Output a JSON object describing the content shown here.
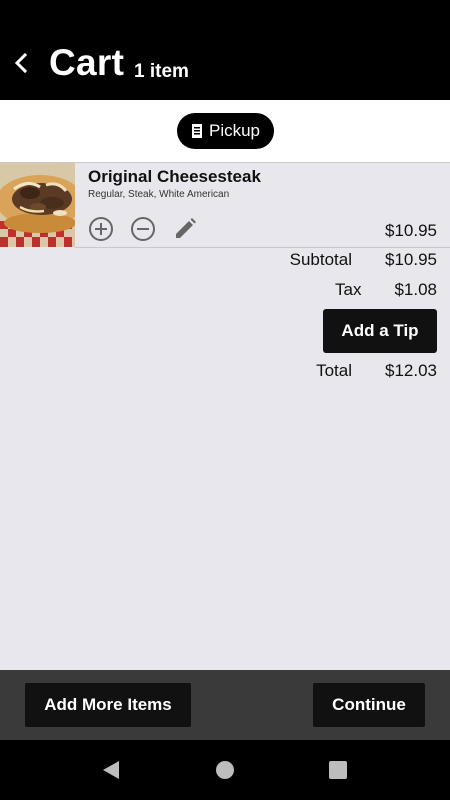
{
  "header": {
    "title": "Cart",
    "item_count": "1 item"
  },
  "order_mode": {
    "label": "Pickup",
    "icon": "receipt-icon"
  },
  "cart_items": [
    {
      "name": "Original Cheesesteak",
      "description": "Regular, Steak, White American",
      "price": "$10.95",
      "image": "cheesesteak-photo",
      "actions": [
        "add-circle-icon",
        "remove-circle-icon",
        "pencil-icon"
      ]
    }
  ],
  "totals": {
    "subtotal_label": "Subtotal",
    "subtotal_value": "$10.95",
    "tax_label": "Tax",
    "tax_value": "$1.08",
    "tip_button": "Add a Tip",
    "total_label": "Total",
    "total_value": "$12.03"
  },
  "footer": {
    "add_more_label": "Add More Items",
    "continue_label": "Continue"
  },
  "system_nav": {
    "icons": [
      "back-triangle-icon",
      "home-circle-icon",
      "recents-square-icon"
    ]
  },
  "colors": {
    "header_bg": "#000000",
    "page_bg": "#e8e7ee",
    "button_bg": "#111111",
    "bottom_bar_bg": "#3a3a3a"
  }
}
